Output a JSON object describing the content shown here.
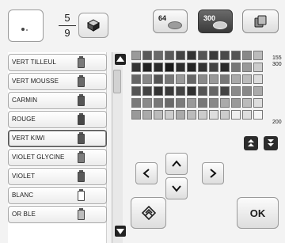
{
  "preview": {
    "numerator": "5",
    "denominator": "9"
  },
  "palette_buttons": [
    {
      "label": "64"
    },
    {
      "label": "300",
      "active": true
    },
    {
      "label": ""
    }
  ],
  "range_labels": {
    "top": "155",
    "second": "300",
    "bottom": "200"
  },
  "threads": [
    {
      "name": "VERT TILLEUL",
      "spool": "#777777"
    },
    {
      "name": "VERT MOUSSE",
      "spool": "#6a6a6a"
    },
    {
      "name": "CARMIN",
      "spool": "#555555"
    },
    {
      "name": "ROUGE",
      "spool": "#474747"
    },
    {
      "name": "VERT KIWI",
      "spool": "#555555",
      "selected": true
    },
    {
      "name": "VIOLET GLYCINE",
      "spool": "#7d7d7d"
    },
    {
      "name": "VIOLET",
      "spool": "#5a5a5a"
    },
    {
      "name": "BLANC",
      "spool": "#ffffff"
    },
    {
      "name": "OR BLE",
      "spool": "#bdbdbd"
    }
  ],
  "ok_label": "OK",
  "icons": {
    "cube": "cube-icon",
    "up": "arrow-up-icon",
    "down": "arrow-down-icon",
    "left": "arrow-left-icon",
    "right": "arrow-right-icon",
    "stamp": "stamp-icon"
  }
}
